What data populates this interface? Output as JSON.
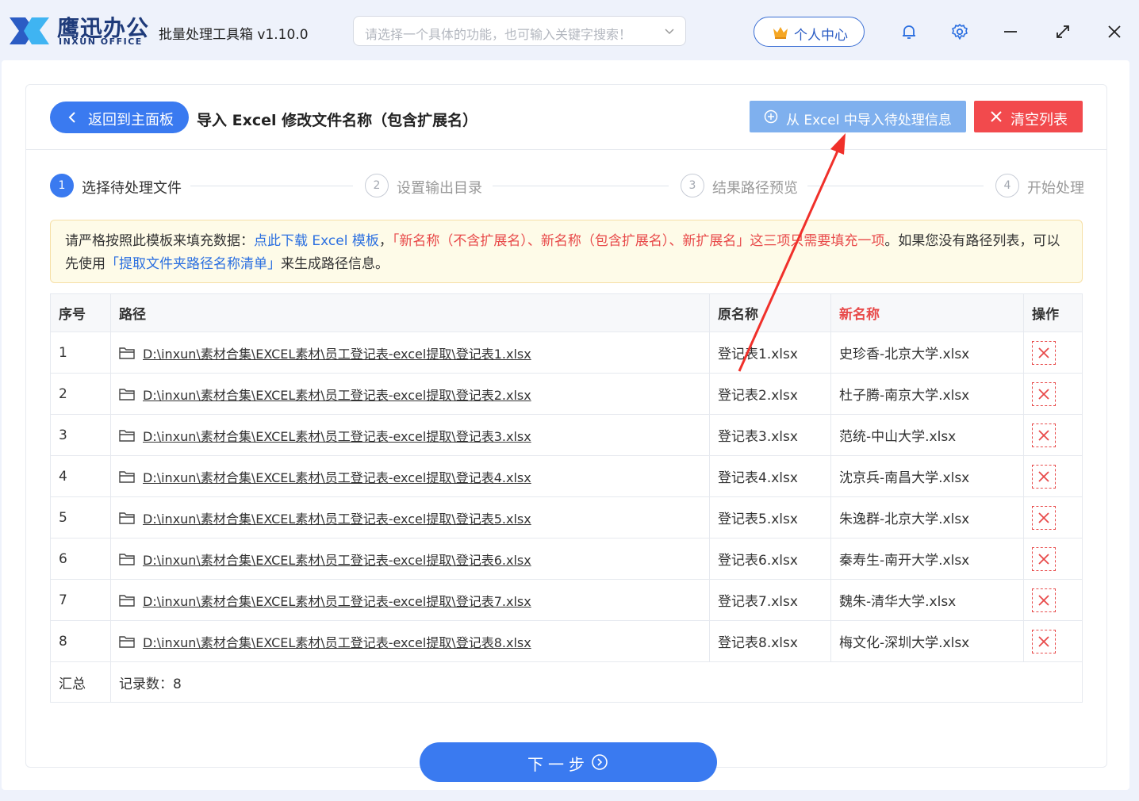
{
  "app": {
    "brand_cn": "鹰迅办公",
    "brand_en": "INXUN OFFICE",
    "title": "批量处理工具箱 v1.10.0",
    "search_placeholder": "请选择一个具体的功能，也可输入关键字搜索！",
    "user_center": "个人中心"
  },
  "header": {
    "back_label": "返回到主面板",
    "page_title": "导入 Excel 修改文件名称（包含扩展名）",
    "import_label": "从 Excel 中导入待处理信息",
    "clear_label": "清空列表"
  },
  "steps": [
    {
      "num": "1",
      "label": "选择待处理文件"
    },
    {
      "num": "2",
      "label": "设置输出目录"
    },
    {
      "num": "3",
      "label": "结果路径预览"
    },
    {
      "num": "4",
      "label": "开始处理"
    }
  ],
  "notice": {
    "t1": "请严格按照此模板来填充数据：",
    "link1": "点此下载 Excel 模板",
    "t2": "，",
    "red": "「新名称（不含扩展名）、新名称（包含扩展名）、新扩展名」这三项只需要填充一项",
    "t3": "。如果您没有路径列表，可以先使用",
    "link2": "「提取文件夹路径名称清单」",
    "t4": "来生成路径信息。"
  },
  "table": {
    "headers": {
      "index": "序号",
      "path": "路径",
      "old_name": "原名称",
      "new_name": "新名称",
      "action": "操作"
    },
    "rows": [
      {
        "index": "1",
        "path": "D:\\inxun\\素材合集\\EXCEL素材\\员工登记表-excel提取\\登记表1.xlsx",
        "old_name": "登记表1.xlsx",
        "new_name": "史珍香-北京大学.xlsx"
      },
      {
        "index": "2",
        "path": "D:\\inxun\\素材合集\\EXCEL素材\\员工登记表-excel提取\\登记表2.xlsx",
        "old_name": "登记表2.xlsx",
        "new_name": "杜子腾-南京大学.xlsx"
      },
      {
        "index": "3",
        "path": "D:\\inxun\\素材合集\\EXCEL素材\\员工登记表-excel提取\\登记表3.xlsx",
        "old_name": "登记表3.xlsx",
        "new_name": "范统-中山大学.xlsx"
      },
      {
        "index": "4",
        "path": "D:\\inxun\\素材合集\\EXCEL素材\\员工登记表-excel提取\\登记表4.xlsx",
        "old_name": "登记表4.xlsx",
        "new_name": "沈京兵-南昌大学.xlsx"
      },
      {
        "index": "5",
        "path": "D:\\inxun\\素材合集\\EXCEL素材\\员工登记表-excel提取\\登记表5.xlsx",
        "old_name": "登记表5.xlsx",
        "new_name": "朱逸群-北京大学.xlsx"
      },
      {
        "index": "6",
        "path": "D:\\inxun\\素材合集\\EXCEL素材\\员工登记表-excel提取\\登记表6.xlsx",
        "old_name": "登记表6.xlsx",
        "new_name": "秦寿生-南开大学.xlsx"
      },
      {
        "index": "7",
        "path": "D:\\inxun\\素材合集\\EXCEL素材\\员工登记表-excel提取\\登记表7.xlsx",
        "old_name": "登记表7.xlsx",
        "new_name": "魏朱-清华大学.xlsx"
      },
      {
        "index": "8",
        "path": "D:\\inxun\\素材合集\\EXCEL素材\\员工登记表-excel提取\\登记表8.xlsx",
        "old_name": "登记表8.xlsx",
        "new_name": "梅文化-深圳大学.xlsx"
      }
    ],
    "summary_label": "汇总",
    "summary_value": "记录数：8"
  },
  "next_label": "下一步",
  "colors": {
    "primary": "#3a7af0",
    "danger": "#f24a4d",
    "import": "#7fb0ee",
    "notice_bg": "#fefbe8"
  }
}
